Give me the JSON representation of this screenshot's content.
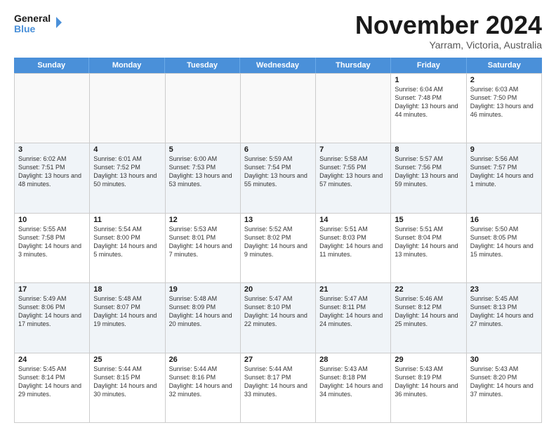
{
  "header": {
    "logo_text_general": "General",
    "logo_text_blue": "Blue",
    "month_title": "November 2024",
    "location": "Yarram, Victoria, Australia"
  },
  "weekdays": [
    "Sunday",
    "Monday",
    "Tuesday",
    "Wednesday",
    "Thursday",
    "Friday",
    "Saturday"
  ],
  "weeks": [
    [
      {
        "day": "",
        "sunrise": "",
        "sunset": "",
        "daylight": "",
        "empty": true
      },
      {
        "day": "",
        "sunrise": "",
        "sunset": "",
        "daylight": "",
        "empty": true
      },
      {
        "day": "",
        "sunrise": "",
        "sunset": "",
        "daylight": "",
        "empty": true
      },
      {
        "day": "",
        "sunrise": "",
        "sunset": "",
        "daylight": "",
        "empty": true
      },
      {
        "day": "",
        "sunrise": "",
        "sunset": "",
        "daylight": "",
        "empty": true
      },
      {
        "day": "1",
        "sunrise": "Sunrise: 6:04 AM",
        "sunset": "Sunset: 7:48 PM",
        "daylight": "Daylight: 13 hours and 44 minutes.",
        "empty": false
      },
      {
        "day": "2",
        "sunrise": "Sunrise: 6:03 AM",
        "sunset": "Sunset: 7:50 PM",
        "daylight": "Daylight: 13 hours and 46 minutes.",
        "empty": false
      }
    ],
    [
      {
        "day": "3",
        "sunrise": "Sunrise: 6:02 AM",
        "sunset": "Sunset: 7:51 PM",
        "daylight": "Daylight: 13 hours and 48 minutes.",
        "empty": false
      },
      {
        "day": "4",
        "sunrise": "Sunrise: 6:01 AM",
        "sunset": "Sunset: 7:52 PM",
        "daylight": "Daylight: 13 hours and 50 minutes.",
        "empty": false
      },
      {
        "day": "5",
        "sunrise": "Sunrise: 6:00 AM",
        "sunset": "Sunset: 7:53 PM",
        "daylight": "Daylight: 13 hours and 53 minutes.",
        "empty": false
      },
      {
        "day": "6",
        "sunrise": "Sunrise: 5:59 AM",
        "sunset": "Sunset: 7:54 PM",
        "daylight": "Daylight: 13 hours and 55 minutes.",
        "empty": false
      },
      {
        "day": "7",
        "sunrise": "Sunrise: 5:58 AM",
        "sunset": "Sunset: 7:55 PM",
        "daylight": "Daylight: 13 hours and 57 minutes.",
        "empty": false
      },
      {
        "day": "8",
        "sunrise": "Sunrise: 5:57 AM",
        "sunset": "Sunset: 7:56 PM",
        "daylight": "Daylight: 13 hours and 59 minutes.",
        "empty": false
      },
      {
        "day": "9",
        "sunrise": "Sunrise: 5:56 AM",
        "sunset": "Sunset: 7:57 PM",
        "daylight": "Daylight: 14 hours and 1 minute.",
        "empty": false
      }
    ],
    [
      {
        "day": "10",
        "sunrise": "Sunrise: 5:55 AM",
        "sunset": "Sunset: 7:58 PM",
        "daylight": "Daylight: 14 hours and 3 minutes.",
        "empty": false
      },
      {
        "day": "11",
        "sunrise": "Sunrise: 5:54 AM",
        "sunset": "Sunset: 8:00 PM",
        "daylight": "Daylight: 14 hours and 5 minutes.",
        "empty": false
      },
      {
        "day": "12",
        "sunrise": "Sunrise: 5:53 AM",
        "sunset": "Sunset: 8:01 PM",
        "daylight": "Daylight: 14 hours and 7 minutes.",
        "empty": false
      },
      {
        "day": "13",
        "sunrise": "Sunrise: 5:52 AM",
        "sunset": "Sunset: 8:02 PM",
        "daylight": "Daylight: 14 hours and 9 minutes.",
        "empty": false
      },
      {
        "day": "14",
        "sunrise": "Sunrise: 5:51 AM",
        "sunset": "Sunset: 8:03 PM",
        "daylight": "Daylight: 14 hours and 11 minutes.",
        "empty": false
      },
      {
        "day": "15",
        "sunrise": "Sunrise: 5:51 AM",
        "sunset": "Sunset: 8:04 PM",
        "daylight": "Daylight: 14 hours and 13 minutes.",
        "empty": false
      },
      {
        "day": "16",
        "sunrise": "Sunrise: 5:50 AM",
        "sunset": "Sunset: 8:05 PM",
        "daylight": "Daylight: 14 hours and 15 minutes.",
        "empty": false
      }
    ],
    [
      {
        "day": "17",
        "sunrise": "Sunrise: 5:49 AM",
        "sunset": "Sunset: 8:06 PM",
        "daylight": "Daylight: 14 hours and 17 minutes.",
        "empty": false
      },
      {
        "day": "18",
        "sunrise": "Sunrise: 5:48 AM",
        "sunset": "Sunset: 8:07 PM",
        "daylight": "Daylight: 14 hours and 19 minutes.",
        "empty": false
      },
      {
        "day": "19",
        "sunrise": "Sunrise: 5:48 AM",
        "sunset": "Sunset: 8:09 PM",
        "daylight": "Daylight: 14 hours and 20 minutes.",
        "empty": false
      },
      {
        "day": "20",
        "sunrise": "Sunrise: 5:47 AM",
        "sunset": "Sunset: 8:10 PM",
        "daylight": "Daylight: 14 hours and 22 minutes.",
        "empty": false
      },
      {
        "day": "21",
        "sunrise": "Sunrise: 5:47 AM",
        "sunset": "Sunset: 8:11 PM",
        "daylight": "Daylight: 14 hours and 24 minutes.",
        "empty": false
      },
      {
        "day": "22",
        "sunrise": "Sunrise: 5:46 AM",
        "sunset": "Sunset: 8:12 PM",
        "daylight": "Daylight: 14 hours and 25 minutes.",
        "empty": false
      },
      {
        "day": "23",
        "sunrise": "Sunrise: 5:45 AM",
        "sunset": "Sunset: 8:13 PM",
        "daylight": "Daylight: 14 hours and 27 minutes.",
        "empty": false
      }
    ],
    [
      {
        "day": "24",
        "sunrise": "Sunrise: 5:45 AM",
        "sunset": "Sunset: 8:14 PM",
        "daylight": "Daylight: 14 hours and 29 minutes.",
        "empty": false
      },
      {
        "day": "25",
        "sunrise": "Sunrise: 5:44 AM",
        "sunset": "Sunset: 8:15 PM",
        "daylight": "Daylight: 14 hours and 30 minutes.",
        "empty": false
      },
      {
        "day": "26",
        "sunrise": "Sunrise: 5:44 AM",
        "sunset": "Sunset: 8:16 PM",
        "daylight": "Daylight: 14 hours and 32 minutes.",
        "empty": false
      },
      {
        "day": "27",
        "sunrise": "Sunrise: 5:44 AM",
        "sunset": "Sunset: 8:17 PM",
        "daylight": "Daylight: 14 hours and 33 minutes.",
        "empty": false
      },
      {
        "day": "28",
        "sunrise": "Sunrise: 5:43 AM",
        "sunset": "Sunset: 8:18 PM",
        "daylight": "Daylight: 14 hours and 34 minutes.",
        "empty": false
      },
      {
        "day": "29",
        "sunrise": "Sunrise: 5:43 AM",
        "sunset": "Sunset: 8:19 PM",
        "daylight": "Daylight: 14 hours and 36 minutes.",
        "empty": false
      },
      {
        "day": "30",
        "sunrise": "Sunrise: 5:43 AM",
        "sunset": "Sunset: 8:20 PM",
        "daylight": "Daylight: 14 hours and 37 minutes.",
        "empty": false
      }
    ]
  ]
}
